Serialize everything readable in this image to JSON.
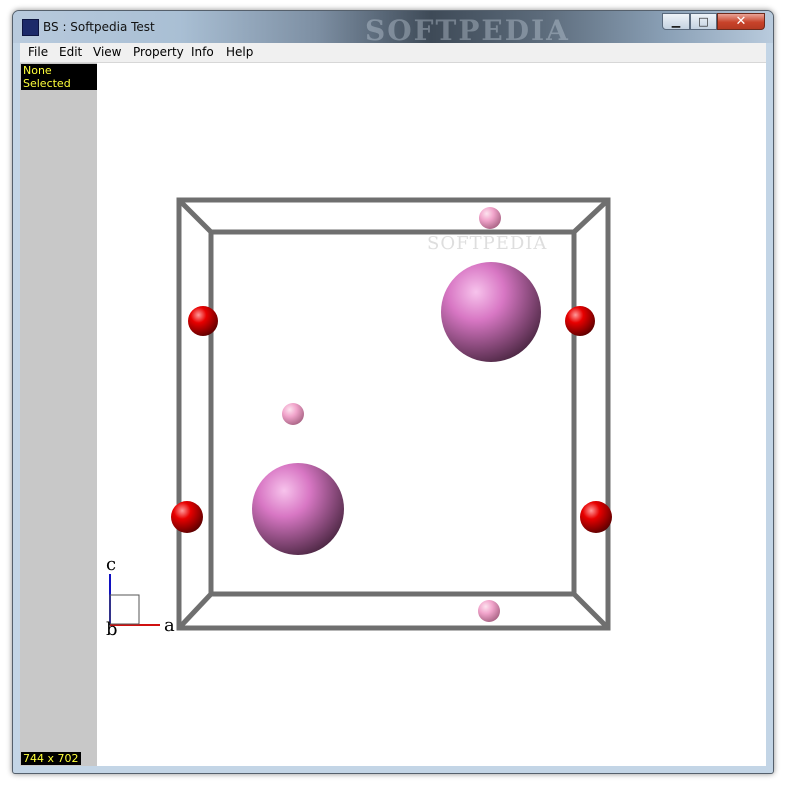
{
  "window": {
    "title": "BS  : Softpedia Test",
    "title_watermark": "SOFTPEDIA",
    "controls": {
      "minimize": "▁",
      "maximize": "□",
      "close": "✕"
    }
  },
  "menu": {
    "items": [
      {
        "label": "File"
      },
      {
        "label": "Edit"
      },
      {
        "label": "View"
      },
      {
        "label": "Property"
      },
      {
        "label": "Info"
      },
      {
        "label": "Help"
      }
    ]
  },
  "status": {
    "selection": "None Selected",
    "viewport_size": "744 x 702"
  },
  "scene": {
    "watermark": "SOFTPEDIA",
    "axes": {
      "a": "a",
      "b": "b",
      "c": "c"
    },
    "colors": {
      "cell_edge": "#6f6f6f",
      "atom_red": "#e00000",
      "atom_large": "#e07bc8",
      "atom_small": "#f1a8cf",
      "axis_a": "#d01010",
      "axis_c": "#1010c0"
    }
  }
}
